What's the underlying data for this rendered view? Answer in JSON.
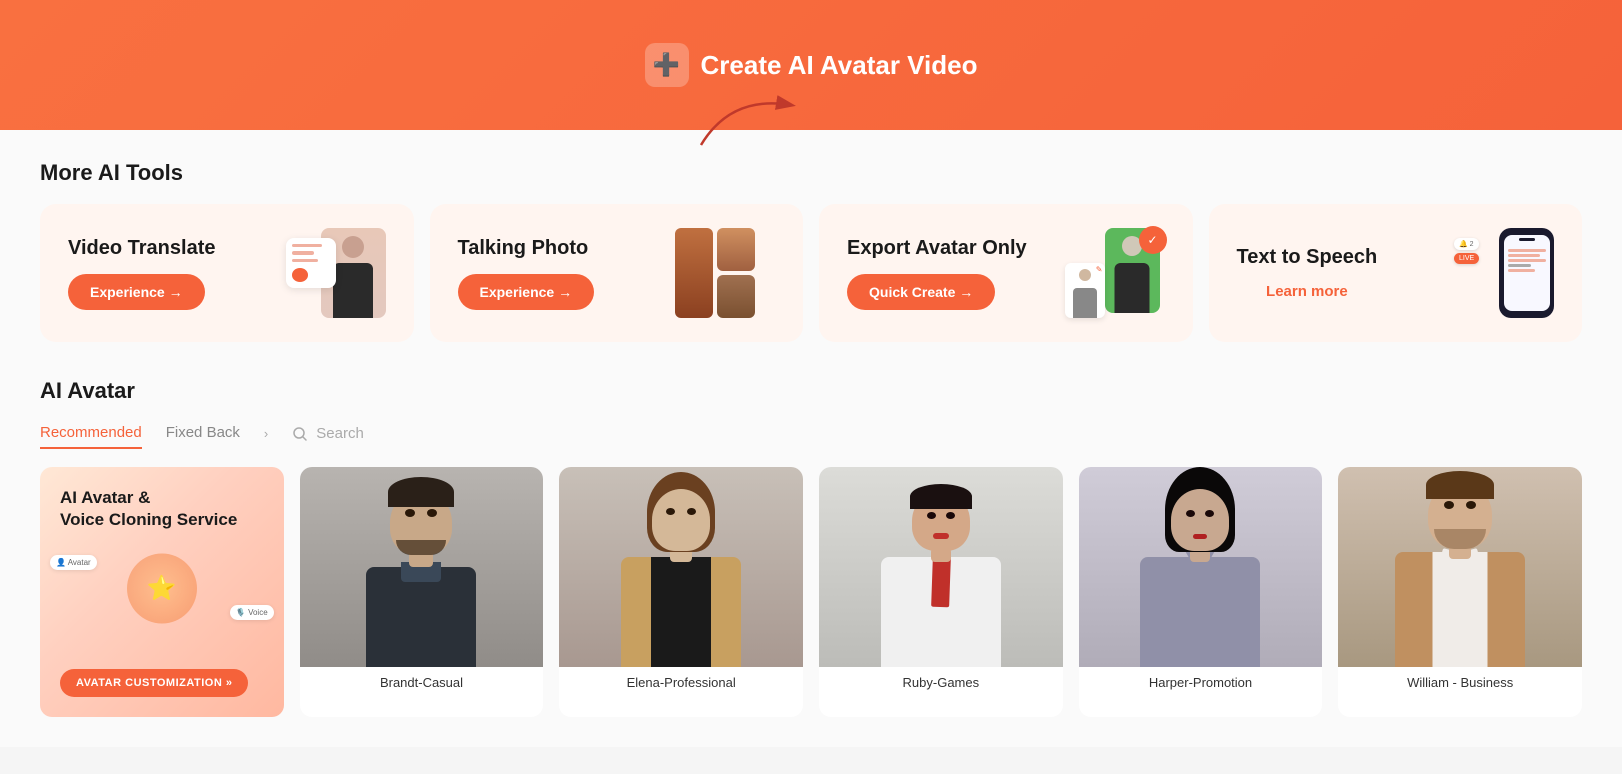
{
  "banner": {
    "label": "Create AI Avatar Video",
    "icon": "➕"
  },
  "more_tools_title": "More AI Tools",
  "tools": [
    {
      "id": "video-translate",
      "name": "Video Translate",
      "btn_label": "Experience →",
      "btn_type": "filled"
    },
    {
      "id": "talking-photo",
      "name": "Talking Photo",
      "btn_label": "Experience →",
      "btn_type": "filled"
    },
    {
      "id": "export-avatar",
      "name": "Export Avatar Only",
      "btn_label": "Quick Create →",
      "btn_type": "filled"
    },
    {
      "id": "text-to-speech",
      "name": "Text to Speech",
      "btn_label": "Learn more",
      "btn_type": "outline"
    }
  ],
  "avatar_section": {
    "title": "AI Avatar",
    "tabs": [
      {
        "id": "recommended",
        "label": "Recommended",
        "active": true
      },
      {
        "id": "fixed-back",
        "label": "Fixed Back",
        "active": false
      }
    ],
    "search_placeholder": "Search"
  },
  "avatars": [
    {
      "id": "promo",
      "type": "promo",
      "title": "AI Avatar &\nVoice Cloning Service",
      "btn": "AVATAR CUSTOMIZATION »"
    },
    {
      "id": "brandt",
      "name": "Brandt-Casual",
      "hot": false,
      "skin": "brandt"
    },
    {
      "id": "elena",
      "name": "Elena-Professional",
      "hot": false,
      "skin": "elena"
    },
    {
      "id": "ruby",
      "name": "Ruby-Games",
      "hot": false,
      "skin": "ruby"
    },
    {
      "id": "harper",
      "name": "Harper-Promotion",
      "hot": false,
      "skin": "harper"
    },
    {
      "id": "william",
      "name": "William - Business",
      "hot": true,
      "skin": "william"
    }
  ],
  "colors": {
    "accent": "#f5623a",
    "hot_badge": "#ff6b9d"
  }
}
